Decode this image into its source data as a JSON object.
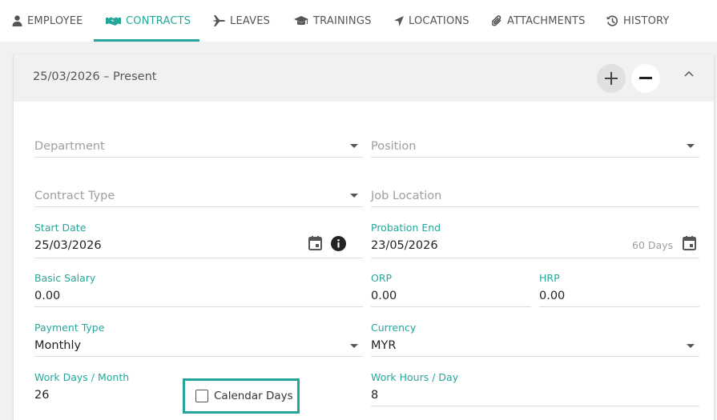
{
  "tabs": [
    {
      "label": "EMPLOYEE",
      "icon": "person-icon"
    },
    {
      "label": "CONTRACTS",
      "icon": "handshake-icon",
      "active": true
    },
    {
      "label": "LEAVES",
      "icon": "airplane-icon"
    },
    {
      "label": "TRAININGS",
      "icon": "graduation-cap-icon"
    },
    {
      "label": "LOCATIONS",
      "icon": "location-arrow-icon"
    },
    {
      "label": "ATTACHMENTS",
      "icon": "paperclip-icon"
    },
    {
      "label": "HISTORY",
      "icon": "history-icon"
    }
  ],
  "contract": {
    "period": "25/03/2026 – Present",
    "department": {
      "placeholder": "Department"
    },
    "position": {
      "placeholder": "Position"
    },
    "contract_type": {
      "placeholder": "Contract Type"
    },
    "job_location": {
      "placeholder": "Job Location"
    },
    "start_date": {
      "label": "Start Date",
      "value": "25/03/2026"
    },
    "probation_end": {
      "label": "Probation End",
      "value": "23/05/2026",
      "days": "60 Days"
    },
    "basic_salary": {
      "label": "Basic Salary",
      "value": "0.00"
    },
    "orp": {
      "label": "ORP",
      "value": "0.00"
    },
    "hrp": {
      "label": "HRP",
      "value": "0.00"
    },
    "payment_type": {
      "label": "Payment Type",
      "value": "Monthly"
    },
    "currency": {
      "label": "Currency",
      "value": "MYR"
    },
    "work_days": {
      "label": "Work Days / Month",
      "value": "26"
    },
    "calendar_days": {
      "label": "Calendar Days",
      "checked": false
    },
    "work_hours": {
      "label": "Work Hours / Day",
      "value": "8"
    }
  },
  "colors": {
    "accent": "#26a69a",
    "header_bg": "#f1f1f1"
  }
}
